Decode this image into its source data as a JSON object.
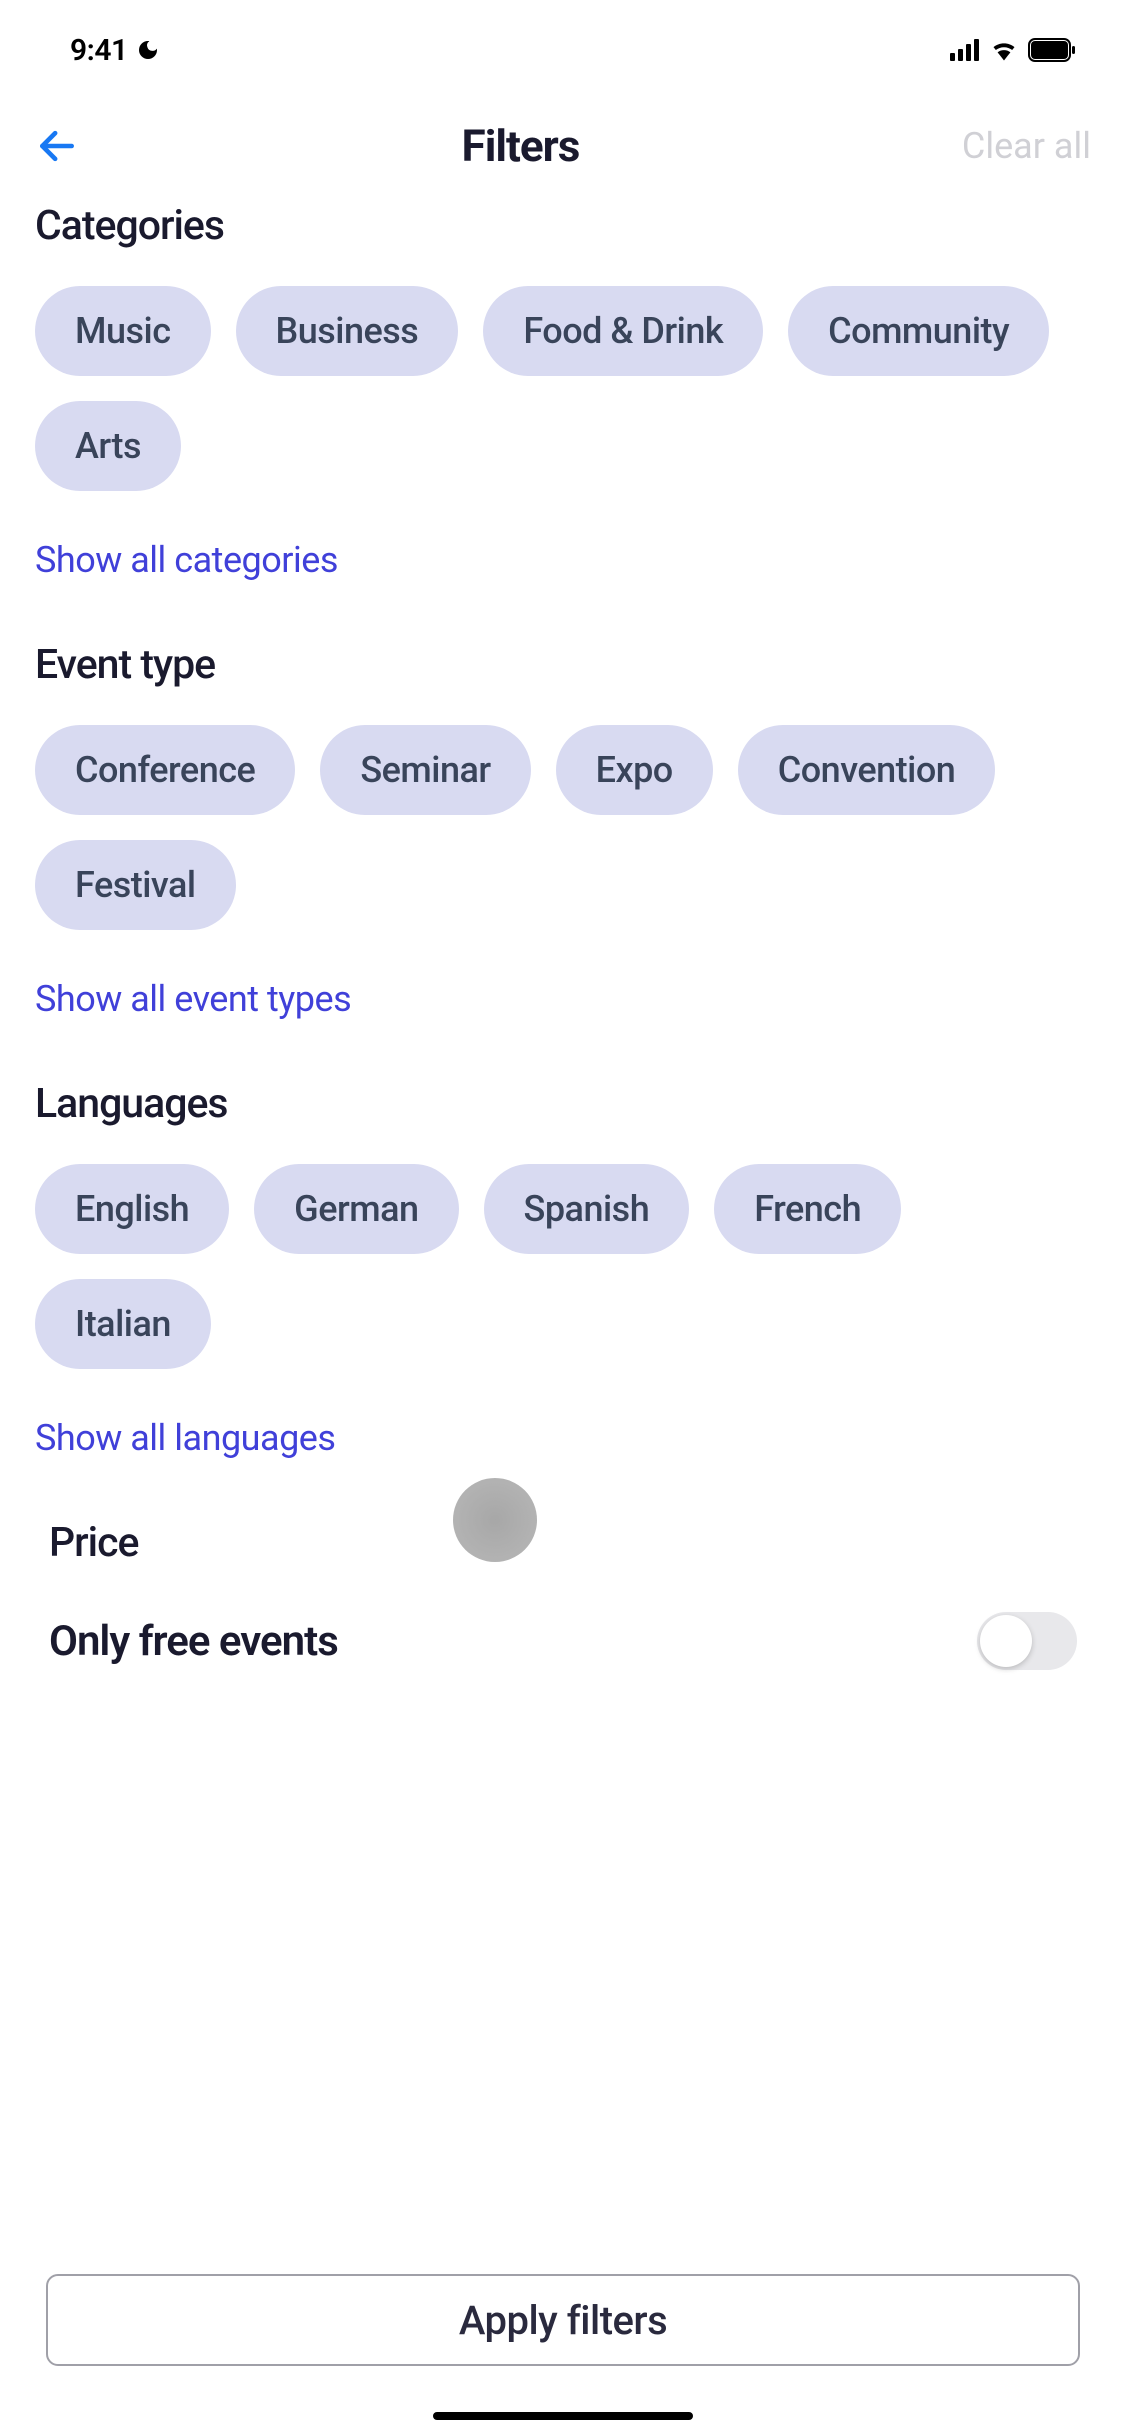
{
  "statusBar": {
    "time": "9:41"
  },
  "header": {
    "title": "Filters",
    "clearAll": "Clear all"
  },
  "categories": {
    "title": "Categories",
    "chips": [
      "Music",
      "Business",
      "Food & Drink",
      "Community",
      "Arts"
    ],
    "showAll": "Show all categories"
  },
  "eventType": {
    "title": "Event type",
    "chips": [
      "Conference",
      "Seminar",
      "Expo",
      "Convention",
      "Festival"
    ],
    "showAll": "Show all event types"
  },
  "languages": {
    "title": "Languages",
    "chips": [
      "English",
      "German",
      "Spanish",
      "French",
      "Italian"
    ],
    "showAll": "Show all languages"
  },
  "price": {
    "title": "Price",
    "toggleLabel": "Only free events",
    "toggleOn": false
  },
  "footer": {
    "applyButton": "Apply filters"
  }
}
